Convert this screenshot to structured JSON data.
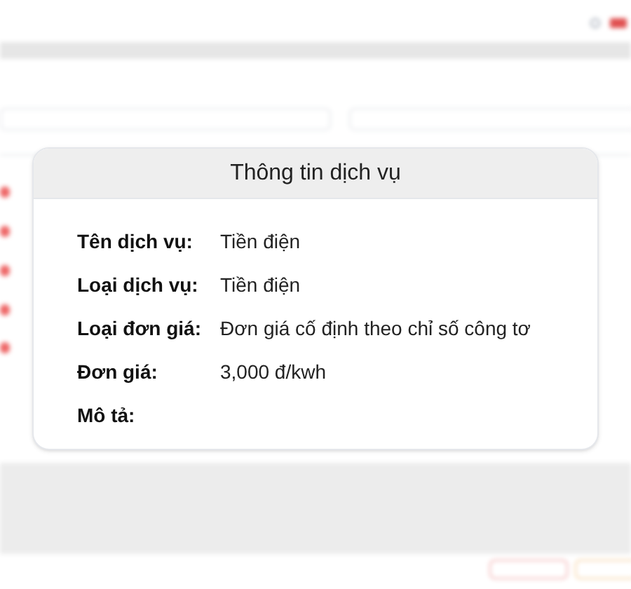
{
  "dialog": {
    "title": "Thông tin dịch vụ",
    "fields": [
      {
        "label": "Tên dịch vụ:",
        "value": "Tiền điện"
      },
      {
        "label": "Loại dịch vụ:",
        "value": "Tiền điện"
      },
      {
        "label": "Loại đơn giá:",
        "value": "Đơn giá cố định theo chỉ số công tơ"
      },
      {
        "label": "Đơn giá:",
        "value": "3,000 đ/kwh"
      },
      {
        "label": "Mô tả:"
      }
    ]
  }
}
